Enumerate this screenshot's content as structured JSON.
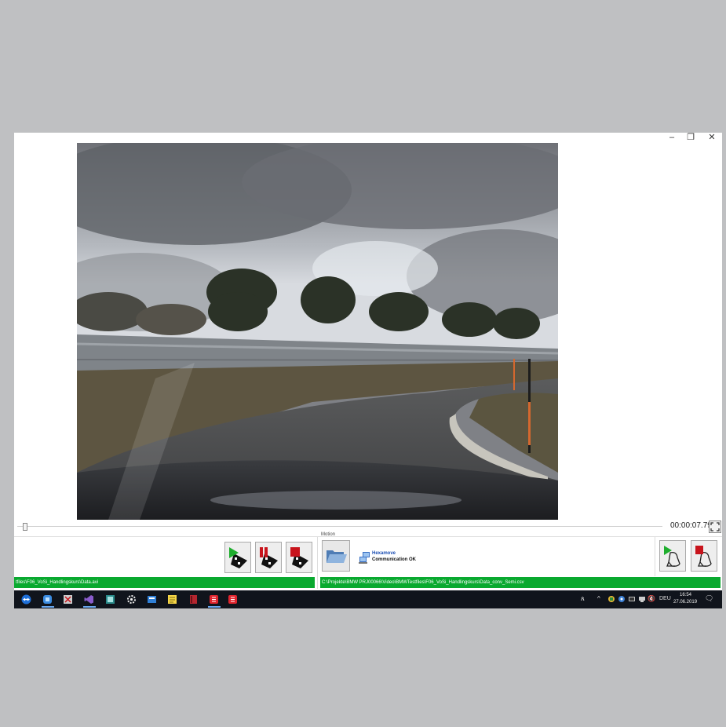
{
  "window": {
    "controls": {
      "minimize": "–",
      "restore": "❐",
      "close": "✕"
    }
  },
  "player": {
    "position_fraction": 0.004,
    "time_display": "00:00:07.796"
  },
  "transport": {
    "buttons": [
      "play-film-icon",
      "pause-film-icon",
      "stop-film-icon"
    ]
  },
  "motion": {
    "group_label": "Motion",
    "device_name": "Hexamove",
    "device_status": "Communication OK"
  },
  "seat_buttons": [
    "seat-play-icon",
    "seat-stop-icon"
  ],
  "status": {
    "video_path": "tfiles\\F06_VoSi_Handlingskurs\\Data.avi",
    "motion_path": "C:\\Projekte\\BMW PRJ00066\\Video\\BMWTestfiles\\F06_VoSi_Handlingskurs\\Data_conv_Semi.csv"
  },
  "taskbar": {
    "apps": [
      "teamviewer-icon",
      "browser-icon",
      "snipping-icon",
      "visual-studio-icon",
      "photos-icon",
      "settings-icon",
      "app-icon",
      "sticky-notes-icon",
      "book-icon",
      "red-app-icon",
      "red-app-icon-2"
    ],
    "tray": {
      "person": "ጰ",
      "chevron": "^",
      "volume": "🔇",
      "language": "DEU"
    },
    "time": "16:54",
    "date": "27.06.2019",
    "notification": "🗨"
  },
  "colors": {
    "status_green": "#09a92f",
    "taskbar": "#10141c",
    "hexamove_blue": "#1a4db3"
  }
}
